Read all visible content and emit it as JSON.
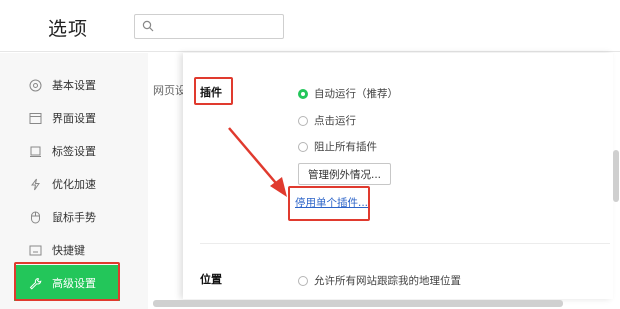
{
  "header": {
    "title": "选项",
    "search": {
      "value": "",
      "placeholder": ""
    }
  },
  "sidebar": {
    "items": [
      {
        "label": "基本设置",
        "icon": "target-icon"
      },
      {
        "label": "界面设置",
        "icon": "window-icon"
      },
      {
        "label": "标签设置",
        "icon": "tab-icon"
      },
      {
        "label": "优化加速",
        "icon": "lightning-icon"
      },
      {
        "label": "鼠标手势",
        "icon": "mouse-icon"
      },
      {
        "label": "快捷键",
        "icon": "keyboard-icon"
      },
      {
        "label": "高级设置",
        "icon": "wrench-icon",
        "active": true
      }
    ]
  },
  "main": {
    "section_label": "网页设",
    "plugins": {
      "title": "插件",
      "options": [
        {
          "label": "自动运行（推荐）",
          "selected": true
        },
        {
          "label": "点击运行",
          "selected": false
        },
        {
          "label": "阻止所有插件",
          "selected": false
        }
      ],
      "manage_button": "管理例外情况...",
      "disable_link": "停用单个插件..."
    },
    "location": {
      "title": "位置",
      "options": [
        {
          "label": "允许所有网站跟踪我的地理位置",
          "selected": false
        }
      ]
    }
  },
  "colors": {
    "accent": "#23c65a",
    "highlight": "#e03a2e",
    "link": "#2b63c8"
  }
}
